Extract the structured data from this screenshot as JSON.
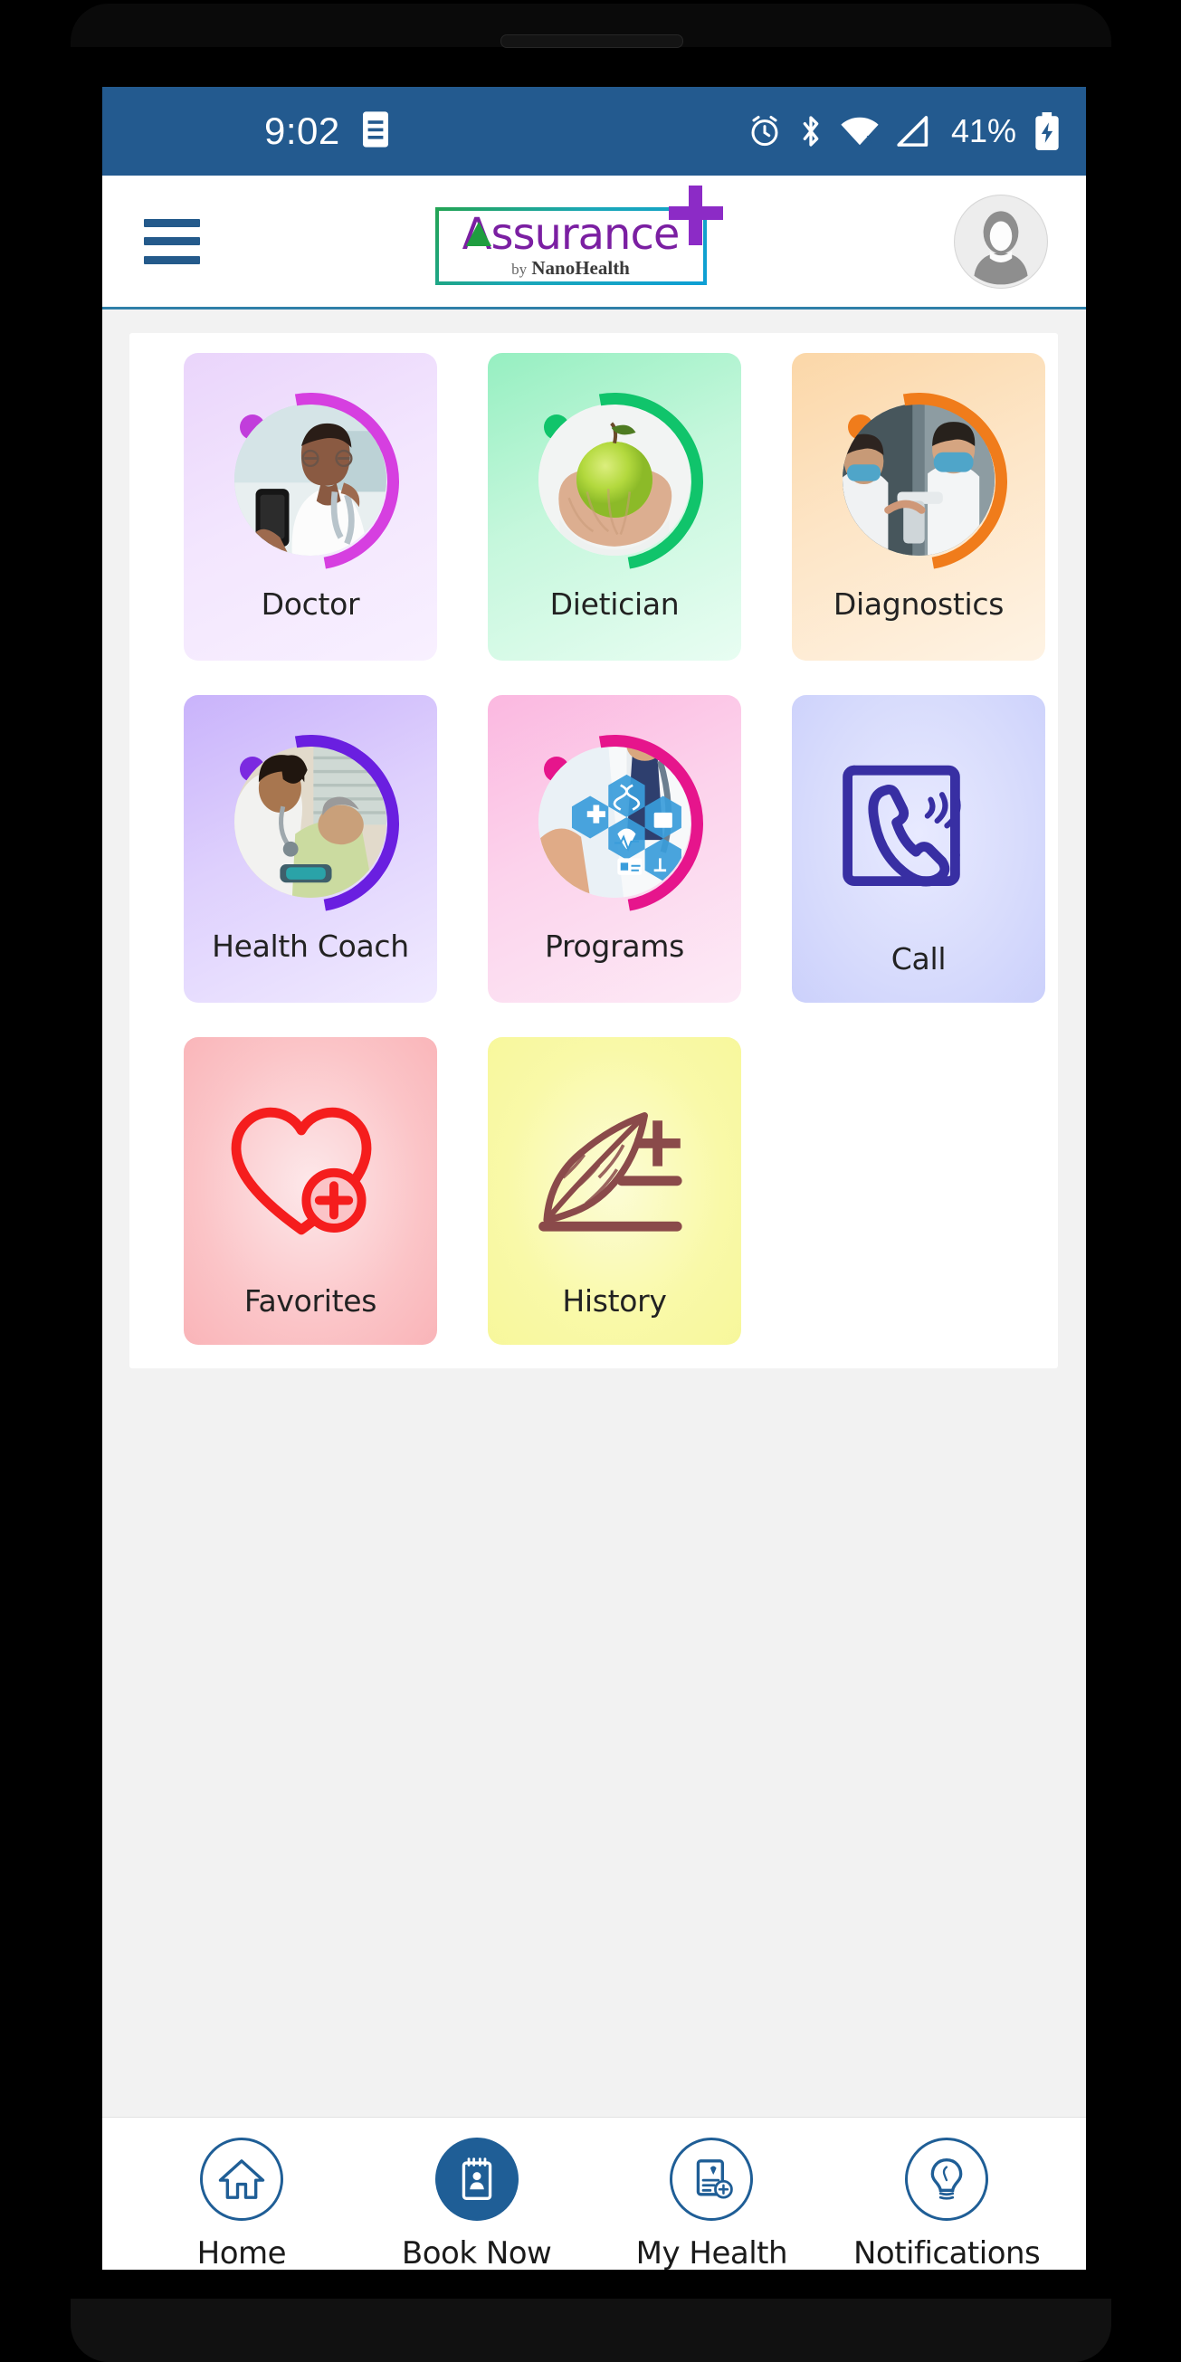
{
  "status_bar": {
    "time": "9:02",
    "battery_percent": "41%",
    "icons": [
      "document-icon",
      "alarm-icon",
      "bluetooth-icon",
      "wifi-icon",
      "cellular-signal-icon",
      "battery-charging-icon"
    ],
    "background_color": "#235a8f"
  },
  "app_bar": {
    "menu_icon": "hamburger-menu-icon",
    "logo": {
      "name": "Assurance",
      "tagline_by": "by",
      "tagline_brand": "NanoHealth",
      "primary_color": "#7b1fa2",
      "accent_color": "#1f9d3f",
      "plus_color": "#8c2bc6"
    },
    "avatar_icon": "user-avatar-icon"
  },
  "services": {
    "rows": [
      [
        {
          "label": "Doctor",
          "icon": "doctor-photo",
          "bg_from": "#ead5fb",
          "bg_to": "#f6ecff",
          "arc": "#d63fe0",
          "dot": "#c13ddb"
        },
        {
          "label": "Dietician",
          "icon": "dietician-photo",
          "bg_from": "#97efc2",
          "bg_to": "#e4fdf0",
          "arc": "#10c46b",
          "dot": "#10c46b"
        },
        {
          "label": "Diagnostics",
          "icon": "diagnostics-photo",
          "bg_from": "#fbd7a8",
          "bg_to": "#fdeedc",
          "arc": "#f07c1b",
          "dot": "#f07c1b"
        }
      ],
      [
        {
          "label": "Health Coach",
          "icon": "health-coach-photo",
          "bg_from": "#c9b3fb",
          "bg_to": "#efe8ff",
          "arc": "#6a1fe0",
          "dot": "#7b2ae0"
        },
        {
          "label": "Programs",
          "icon": "programs-photo",
          "bg_from": "#fbb8e0",
          "bg_to": "#fde9f5",
          "arc": "#e6158c",
          "dot": "#e6158c"
        },
        {
          "label": "Call",
          "icon": "phone-call-icon",
          "bg_from": "#cfd3fb",
          "bg_to": "#e6e8ff",
          "arc": "#3b2fa8",
          "dot": "#3b2fa8"
        }
      ],
      [
        {
          "label": "Favorites",
          "icon": "heart-plus-icon",
          "bg_from": "#fbb9bc",
          "bg_to": "#fde4e6",
          "arc": "#f51d1d",
          "dot": "#f51d1d"
        },
        {
          "label": "History",
          "icon": "quill-history-icon",
          "bg_from": "#f9f9a6",
          "bg_to": "#fdfddc",
          "arc": "#8a4a4a",
          "dot": "#8a4a4a"
        }
      ]
    ]
  },
  "bottom_nav": {
    "items": [
      {
        "label": "Home",
        "icon": "home-icon",
        "active": false
      },
      {
        "label": "Book Now",
        "icon": "booking-notepad-icon",
        "active": true
      },
      {
        "label": "My Health",
        "icon": "health-record-icon",
        "active": false
      },
      {
        "label": "Notifications",
        "icon": "lightbulb-icon",
        "active": false
      }
    ],
    "accent_color": "#1f5e96"
  }
}
